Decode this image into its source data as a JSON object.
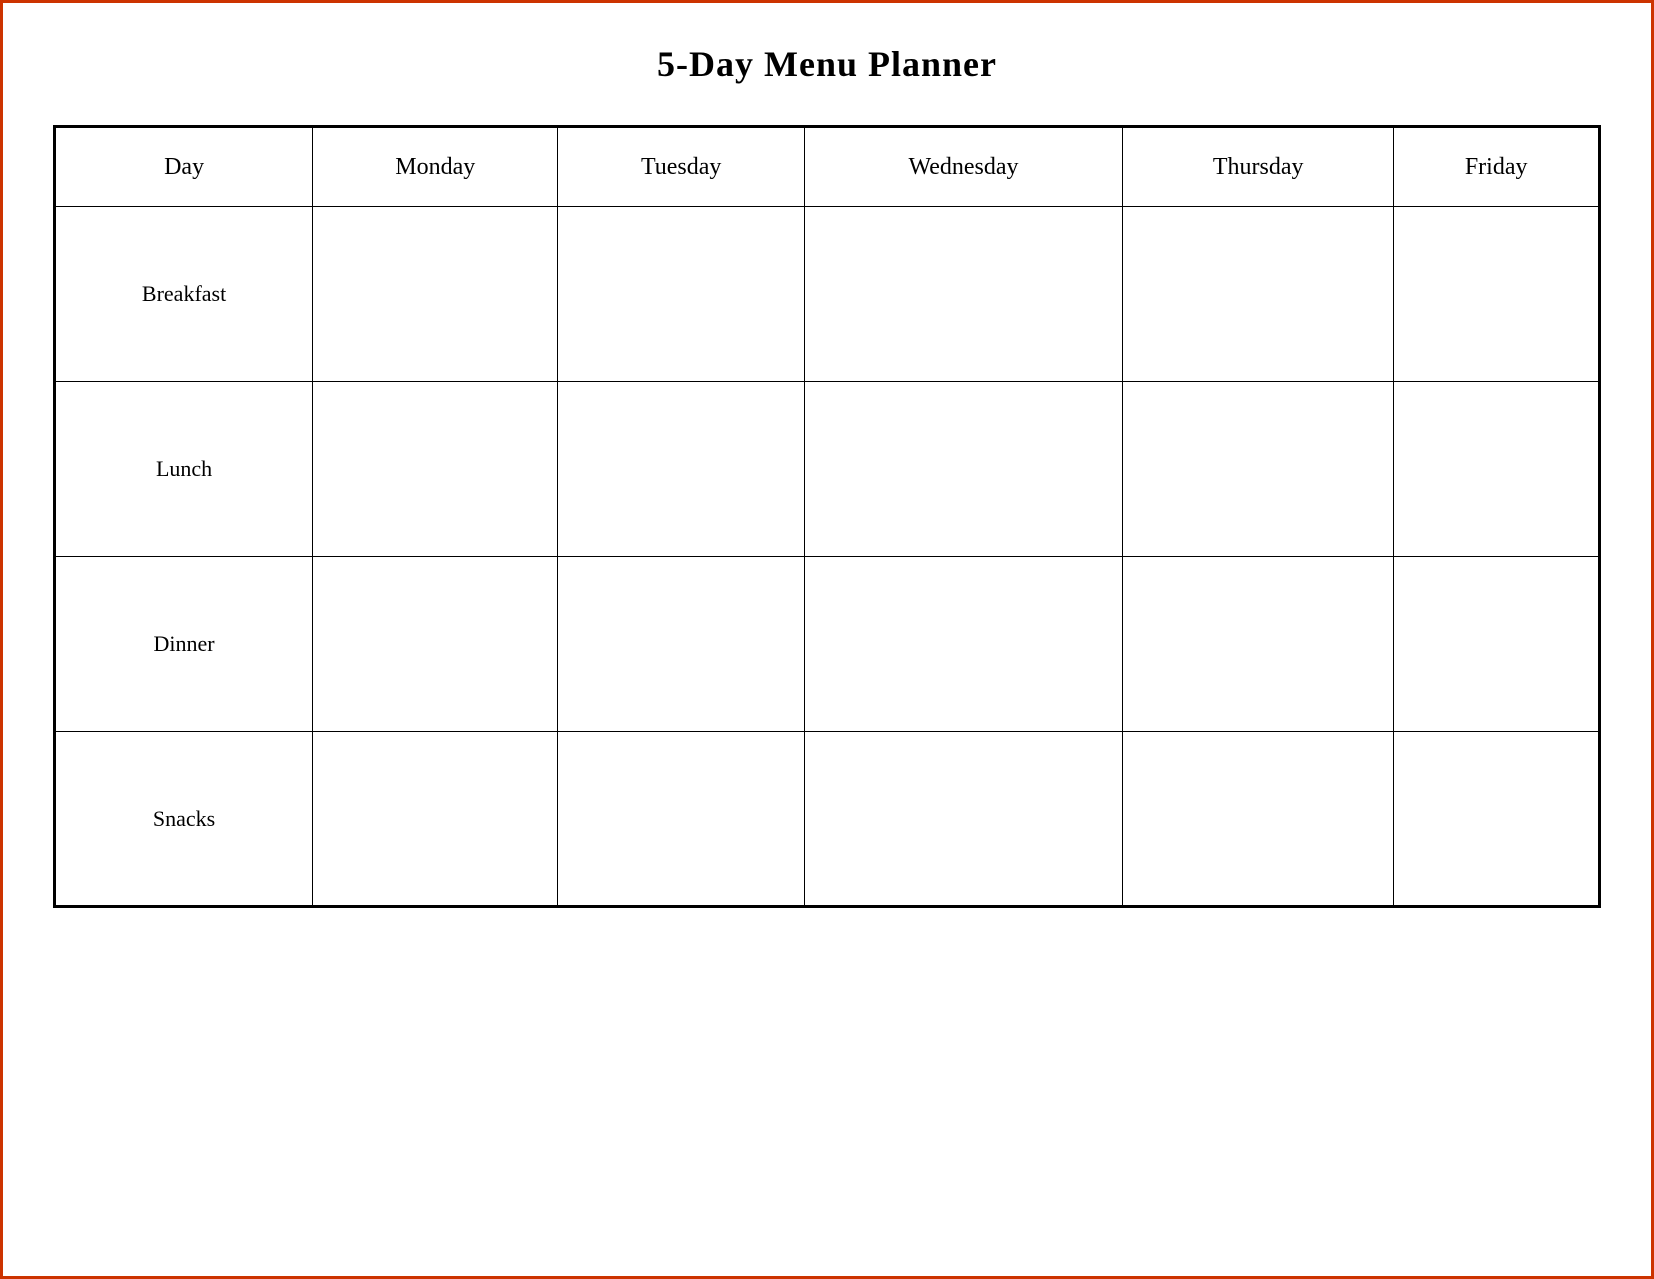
{
  "title": "5-Day Menu Planner",
  "columns": {
    "day": "Day",
    "monday": "Monday",
    "tuesday": "Tuesday",
    "wednesday": "Wednesday",
    "thursday": "Thursday",
    "friday": "Friday"
  },
  "meals": [
    {
      "id": "breakfast",
      "label": "Breakfast"
    },
    {
      "id": "lunch",
      "label": "Lunch"
    },
    {
      "id": "dinner",
      "label": "Dinner"
    },
    {
      "id": "snacks",
      "label": "Snacks"
    }
  ]
}
